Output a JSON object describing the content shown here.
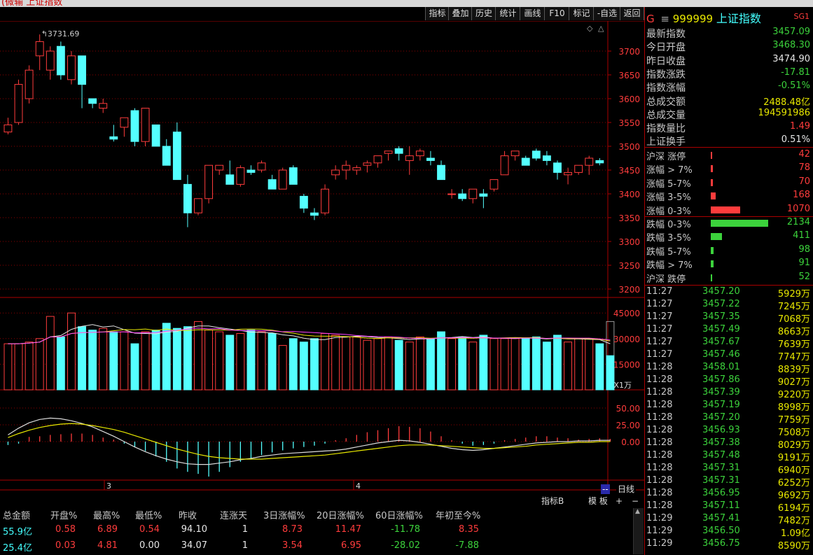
{
  "window": {
    "title_fragment": "(微输 上证指数"
  },
  "toolbar": {
    "buttons": [
      "指标",
      "叠加",
      "历史",
      "统计",
      "画线",
      "F10",
      "标记",
      "-自选",
      "返回"
    ]
  },
  "chart_data": {
    "type": "candlestick",
    "price_ticks": [
      "3700",
      "3650",
      "3600",
      "3550",
      "3500",
      "3450",
      "3400",
      "3350",
      "3300",
      "3250",
      "3200"
    ],
    "price_range": [
      3200,
      3700
    ],
    "high_marker": "3731.69",
    "candles": [
      [
        3530,
        3560,
        3525,
        3545
      ],
      [
        3550,
        3640,
        3545,
        3630
      ],
      [
        3600,
        3670,
        3590,
        3660
      ],
      [
        3690,
        3735,
        3660,
        3720
      ],
      [
        3660,
        3710,
        3640,
        3700
      ],
      [
        3710,
        3720,
        3640,
        3650
      ],
      [
        3640,
        3700,
        3630,
        3690
      ],
      [
        3690,
        3690,
        3580,
        3630
      ],
      [
        3600,
        3600,
        3580,
        3590
      ],
      [
        3580,
        3600,
        3570,
        3590
      ],
      [
        3520,
        3545,
        3510,
        3515
      ],
      [
        3540,
        3560,
        3520,
        3560
      ],
      [
        3575,
        3580,
        3500,
        3510
      ],
      [
        3510,
        3580,
        3500,
        3580
      ],
      [
        3545,
        3545,
        3500,
        3500
      ],
      [
        3500,
        3515,
        3460,
        3460
      ],
      [
        3530,
        3550,
        3430,
        3430
      ],
      [
        3420,
        3440,
        3330,
        3360
      ],
      [
        3360,
        3390,
        3355,
        3390
      ],
      [
        3390,
        3460,
        3380,
        3460
      ],
      [
        3450,
        3460,
        3440,
        3460
      ],
      [
        3440,
        3470,
        3420,
        3420
      ],
      [
        3420,
        3460,
        3415,
        3455
      ],
      [
        3450,
        3460,
        3440,
        3445
      ],
      [
        3450,
        3470,
        3445,
        3465
      ],
      [
        3430,
        3440,
        3410,
        3410
      ],
      [
        3410,
        3455,
        3410,
        3450
      ],
      [
        3455,
        3460,
        3420,
        3420
      ],
      [
        3395,
        3400,
        3360,
        3370
      ],
      [
        3360,
        3370,
        3345,
        3355
      ],
      [
        3360,
        3420,
        3355,
        3410
      ],
      [
        3440,
        3460,
        3430,
        3450
      ],
      [
        3450,
        3470,
        3430,
        3460
      ],
      [
        3450,
        3460,
        3440,
        3455
      ],
      [
        3460,
        3470,
        3445,
        3465
      ],
      [
        3465,
        3480,
        3455,
        3480
      ],
      [
        3485,
        3490,
        3470,
        3490
      ],
      [
        3495,
        3500,
        3470,
        3485
      ],
      [
        3470,
        3500,
        3440,
        3480
      ],
      [
        3480,
        3495,
        3470,
        3490
      ],
      [
        3475,
        3490,
        3460,
        3470
      ],
      [
        3460,
        3470,
        3430,
        3430
      ],
      [
        3400,
        3410,
        3390,
        3400
      ],
      [
        3400,
        3410,
        3385,
        3390
      ],
      [
        3390,
        3410,
        3380,
        3410
      ],
      [
        3400,
        3410,
        3370,
        3395
      ],
      [
        3410,
        3430,
        3405,
        3430
      ],
      [
        3440,
        3490,
        3440,
        3480
      ],
      [
        3480,
        3490,
        3470,
        3490
      ],
      [
        3475,
        3480,
        3460,
        3460
      ],
      [
        3490,
        3495,
        3470,
        3475
      ],
      [
        3480,
        3490,
        3460,
        3470
      ],
      [
        3465,
        3470,
        3430,
        3445
      ],
      [
        3440,
        3455,
        3420,
        3445
      ],
      [
        3445,
        3460,
        3440,
        3460
      ],
      [
        3460,
        3480,
        3440,
        3475
      ],
      [
        3470,
        3475,
        3460,
        3465
      ]
    ],
    "volume_ticks": [
      "45000",
      "30000",
      "15000"
    ],
    "volume_unit": "X1万",
    "volume_range": [
      0,
      50000
    ],
    "macd_ticks": [
      "50.00",
      "25.00",
      "0.00"
    ],
    "x_labels": [
      "3",
      "4"
    ]
  },
  "quote": {
    "code": "999999",
    "name": "上证指数",
    "prefix": "G",
    "suffix": "SG1",
    "rows": [
      {
        "label": "最新指数",
        "value": "3457.09",
        "color": "#3cd23c"
      },
      {
        "label": "今日开盘",
        "value": "3468.30",
        "color": "#3cd23c"
      },
      {
        "label": "昨日收盘",
        "value": "3474.90",
        "color": "#e6e6e6"
      },
      {
        "label": "指数涨跌",
        "value": "-17.81",
        "color": "#3cd23c"
      },
      {
        "label": "指数涨幅",
        "value": "-0.51%",
        "color": "#3cd23c"
      },
      {
        "label": "总成交额",
        "value": "2488.48亿",
        "color": "#e8e800"
      },
      {
        "label": "总成交量",
        "value": "194591986",
        "color": "#e8e800"
      },
      {
        "label": "指数量比",
        "value": "1.49",
        "color": "#ff3c3c"
      },
      {
        "label": "上证换手",
        "value": "0.51%",
        "color": "#e6e6e6"
      }
    ]
  },
  "distribution": [
    {
      "label": "沪深 涨停",
      "value": "42",
      "bar": 2,
      "color": "#ff3c3c"
    },
    {
      "label": "涨幅 > 7%",
      "value": "78",
      "bar": 3,
      "color": "#ff3c3c"
    },
    {
      "label": "涨幅 5-7%",
      "value": "70",
      "bar": 3,
      "color": "#ff3c3c"
    },
    {
      "label": "涨幅 3-5%",
      "value": "168",
      "bar": 7,
      "color": "#ff3c3c"
    },
    {
      "label": "涨幅 0-3%",
      "value": "1070",
      "bar": 42,
      "color": "#ff3c3c"
    },
    {
      "label": "跌幅 0-3%",
      "value": "2134",
      "bar": 82,
      "color": "#3cd23c"
    },
    {
      "label": "跌幅 3-5%",
      "value": "411",
      "bar": 16,
      "color": "#3cd23c"
    },
    {
      "label": "跌幅 5-7%",
      "value": "98",
      "bar": 4,
      "color": "#3cd23c"
    },
    {
      "label": "跌幅 > 7%",
      "value": "91",
      "bar": 4,
      "color": "#3cd23c"
    },
    {
      "label": "沪深 跌停",
      "value": "52",
      "bar": 2,
      "color": "#3cd23c"
    }
  ],
  "ticks": [
    [
      "11:27",
      "3457.20",
      "5929万"
    ],
    [
      "11:27",
      "3457.22",
      "7245万"
    ],
    [
      "11:27",
      "3457.35",
      "7068万"
    ],
    [
      "11:27",
      "3457.49",
      "8663万"
    ],
    [
      "11:27",
      "3457.67",
      "7639万"
    ],
    [
      "11:27",
      "3457.46",
      "7747万"
    ],
    [
      "11:28",
      "3458.01",
      "8839万"
    ],
    [
      "11:28",
      "3457.86",
      "9027万"
    ],
    [
      "11:28",
      "3457.39",
      "9220万"
    ],
    [
      "11:28",
      "3457.19",
      "8998万"
    ],
    [
      "11:28",
      "3457.20",
      "7759万"
    ],
    [
      "11:28",
      "3456.93",
      "7508万"
    ],
    [
      "11:28",
      "3457.38",
      "8029万"
    ],
    [
      "11:28",
      "3457.48",
      "9191万"
    ],
    [
      "11:28",
      "3457.31",
      "6940万"
    ],
    [
      "11:28",
      "3457.31",
      "6252万"
    ],
    [
      "11:28",
      "3456.95",
      "9692万"
    ],
    [
      "11:28",
      "3457.11",
      "6194万"
    ],
    [
      "11:29",
      "3457.41",
      "7482万"
    ],
    [
      "11:29",
      "3456.50",
      "1.09亿"
    ],
    [
      "11:29",
      "3456.75",
      "8590万"
    ]
  ],
  "panel_controls": {
    "day_line": "日线",
    "indicator": "指标B",
    "template": "模 板",
    "plus": "+",
    "minus": "−",
    "collapse": "--"
  },
  "bottom": {
    "headers": [
      "总金额",
      "开盘%",
      "最高%",
      "最低%",
      "昨收",
      "连涨天",
      "3日涨幅%",
      "20日涨幅%",
      "60日涨幅%",
      "年初至今%"
    ],
    "rows": [
      [
        "55.9亿",
        "0.58",
        "6.89",
        "0.54",
        "94.10",
        "1",
        "8.73",
        "11.47",
        "-11.78",
        "8.35"
      ],
      [
        "25.4亿",
        "0.03",
        "4.81",
        "0.00",
        "34.07",
        "1",
        "3.54",
        "6.95",
        "-28.02",
        "-7.88"
      ]
    ]
  }
}
